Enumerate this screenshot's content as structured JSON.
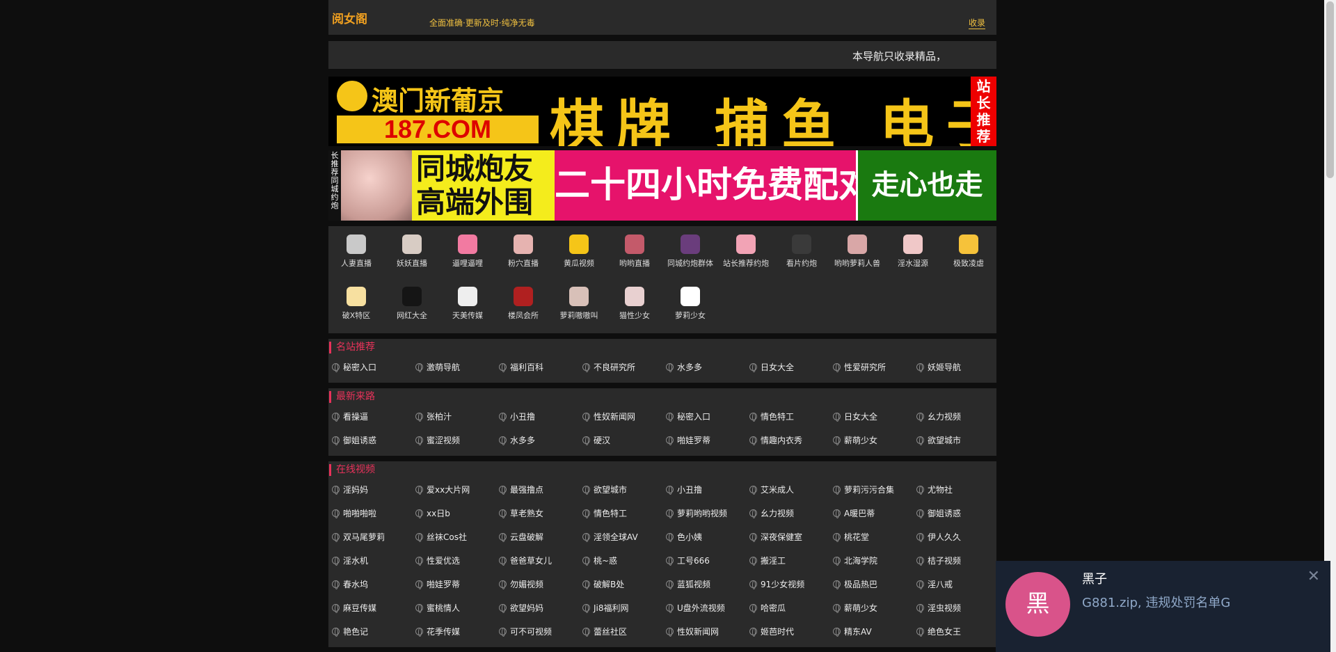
{
  "header": {
    "logo": "阅女阁",
    "tagline": "全面准确·更新及时·纯净无毒",
    "collect": "收录"
  },
  "notice": "本导航只收录精品，",
  "banner1": {
    "brand_top": "澳门新葡京",
    "brand_bottom": "187.COM",
    "slogan": "棋牌 捕鱼 电子",
    "side": "站长推荐"
  },
  "banner2": {
    "vertical": "长推荐 同城约炮",
    "yellow_line1": "同城炮友",
    "yellow_line2": "高端外围",
    "pink": "二十四小时免费配对",
    "green": "走心也走肾"
  },
  "apps": [
    {
      "label": "人妻直播",
      "color": "#c9c9c9"
    },
    {
      "label": "妖妖直播",
      "color": "#d8ccc4"
    },
    {
      "label": "逼哩逼哩",
      "color": "#f27aa1"
    },
    {
      "label": "粉穴直播",
      "color": "#e6b3b0"
    },
    {
      "label": "黄瓜视频",
      "color": "#f5c518"
    },
    {
      "label": "哟哟直播",
      "color": "#c45a6a"
    },
    {
      "label": "同城约炮群体",
      "color": "#6a3d7c"
    },
    {
      "label": "站长推荐约炮",
      "color": "#f2a3b5"
    },
    {
      "label": "看片约炮",
      "color": "#3a3a3a"
    },
    {
      "label": "哟哟萝莉人兽",
      "color": "#d9a7a7"
    },
    {
      "label": "淫水湿源",
      "color": "#f0c8c8"
    },
    {
      "label": "极致凌虐",
      "color": "#f6c23a"
    },
    {
      "label": "破X特区",
      "color": "#f7e0a0"
    },
    {
      "label": "网红大全",
      "color": "#151515"
    },
    {
      "label": "天美传媒",
      "color": "#eeeeee"
    },
    {
      "label": "楼凤会所",
      "color": "#b02020"
    },
    {
      "label": "萝莉嗷嗷叫",
      "color": "#d8c0b8"
    },
    {
      "label": "猫性少女",
      "color": "#e8d0d0"
    },
    {
      "label": "萝莉少女",
      "color": "#ffffff"
    }
  ],
  "sections": [
    {
      "title": "名站推荐",
      "links": [
        "秘密入口",
        "激萌导航",
        "福利百科",
        "不良研究所",
        "水多多",
        "日女大全",
        "性爱研究所",
        "妖姬导航"
      ]
    },
    {
      "title": "最新来路",
      "links": [
        "看操逼",
        "张柏汁",
        "小丑撸",
        "性奴新闻网",
        "秘密入口",
        "情色特工",
        "日女大全",
        "幺力视频",
        "御姐诱惑",
        "蜜涩视频",
        "水多多",
        "硬汉",
        "啪娃罗蒂",
        "情趣内衣秀",
        "薪萌少女",
        "欲望城市"
      ]
    },
    {
      "title": "在线视频",
      "links": [
        "淫妈妈",
        "爱xx大片网",
        "最强撸点",
        "欲望城市",
        "小丑撸",
        "艾米成人",
        "萝莉污污合集",
        "尤物社",
        "啪啪啪啦",
        "xx日b",
        "草老熟女",
        "情色特工",
        "萝莉哟哟视频",
        "幺力视频",
        "A暖巴蒂",
        "御姐诱惑",
        "双马尾萝莉",
        "丝袜Cos社",
        "云盘破解",
        "淫领全球AV",
        "色小姨",
        "深夜保健室",
        "桃花堂",
        "伊人久久",
        "淫水机",
        "性爱优选",
        "爸爸草女儿",
        "桃~惑",
        "工号666",
        "搬淫工",
        "北海学院",
        "桔子视频",
        "春水坞",
        "啪娃罗蒂",
        "勿媚视频",
        "破解B处",
        "蓝狐视频",
        "91少女视频",
        "极品热巴",
        "淫八戒",
        "麻豆传媒",
        "蜜桃情人",
        "欲望妈妈",
        "Ji8福利网",
        "U盘外流视频",
        "哈密瓜",
        "薪萌少女",
        "淫虫视频",
        "艳色记",
        "花季传媒",
        "可不可视频",
        "蕾丝社区",
        "性奴新闻网",
        "姬芭时代",
        "精东AV",
        "绝色女王"
      ]
    }
  ],
  "toast": {
    "avatar_text": "黑",
    "name": "黑子",
    "message": "G881.zip, 违规处罚名单G",
    "close": "✕"
  }
}
